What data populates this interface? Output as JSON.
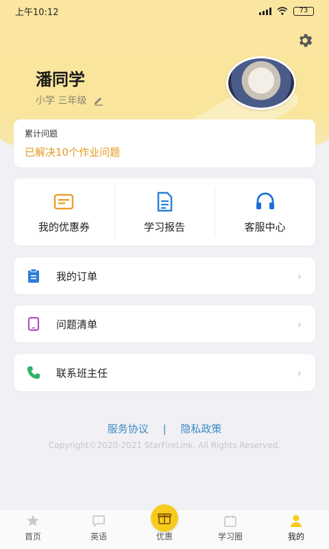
{
  "status_bar": {
    "time": "上午10:12",
    "battery": "73"
  },
  "profile": {
    "name": "潘同学",
    "grade": "小学  三年级"
  },
  "stats": {
    "title": "累计问题",
    "value": "已解决10个作业问题"
  },
  "quick_actions": [
    {
      "label": "我的优惠券",
      "icon": "coupon-icon",
      "color": "#e8a22e"
    },
    {
      "label": "学习报告",
      "icon": "report-icon",
      "color": "#2b7fd6"
    },
    {
      "label": "客服中心",
      "icon": "headset-icon",
      "color": "#1f6fd9"
    }
  ],
  "menu": [
    {
      "label": "我的订单",
      "icon": "clipboard-icon",
      "color": "#2b7fd6"
    },
    {
      "label": "问题清单",
      "icon": "tablet-icon",
      "color": "#b04fc6"
    },
    {
      "label": "联系班主任",
      "icon": "phone-icon",
      "color": "#2fb36a"
    }
  ],
  "footer": {
    "service_link": "服务协议",
    "separator": "|",
    "privacy_link": "隐私政策",
    "copyright": "Copyright©2020-2021 StarFireLink. All Rights Reserved."
  },
  "tabs": [
    {
      "label": "首页",
      "icon": "star-icon"
    },
    {
      "label": "英语",
      "icon": "chat-icon"
    },
    {
      "label": "优惠",
      "icon": "gift-icon"
    },
    {
      "label": "学习圈",
      "icon": "calendar-icon"
    },
    {
      "label": "我的",
      "icon": "person-icon"
    }
  ],
  "colors": {
    "accent": "#f7cb1e",
    "link": "#3a8bc4",
    "stat_highlight": "#e39a1f"
  }
}
